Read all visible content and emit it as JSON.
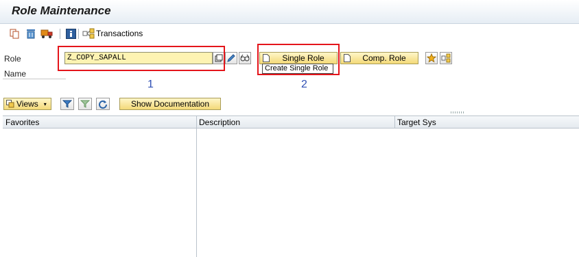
{
  "window": {
    "title": "Role Maintenance"
  },
  "toolbar": {
    "transactions_label": "Transactions",
    "icons": [
      "copy-icon",
      "delete-icon",
      "transport-icon",
      "info-icon",
      "transactions-icon"
    ]
  },
  "role_form": {
    "role_label": "Role",
    "name_label": "Name",
    "role_value": "Z_COPY_SAPALL",
    "single_role_label": "Single Role",
    "composite_role_label": "Comp. Role",
    "tooltip": "Create Single Role"
  },
  "annotations": {
    "marker_1": "1",
    "marker_2": "2",
    "highlight_color": "#e4141a",
    "marker_color": "#2f4fb4"
  },
  "tree_toolbar": {
    "views_label": "Views",
    "show_documentation_label": "Show Documentation"
  },
  "tree": {
    "columns": [
      "Favorites",
      "Description",
      "Target Sys"
    ],
    "rows": []
  },
  "colors": {
    "input_bg": "#fdf3b2",
    "button_bg": "#f3d978"
  }
}
